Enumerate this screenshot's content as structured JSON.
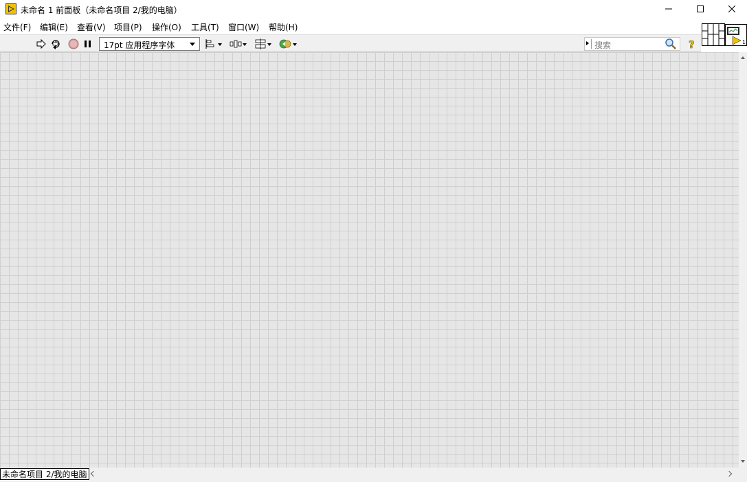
{
  "window": {
    "title": "未命名 1 前面板（未命名项目 2/我的电脑）",
    "icons": {
      "app": "labview-run-icon",
      "minimize": "minimize-icon",
      "maximize": "maximize-icon",
      "close": "close-icon"
    }
  },
  "menubar": {
    "items": [
      {
        "label": "文件(F)"
      },
      {
        "label": "编辑(E)"
      },
      {
        "label": "查看(V)"
      },
      {
        "label": "项目(P)"
      },
      {
        "label": "操作(O)"
      },
      {
        "label": "工具(T)"
      },
      {
        "label": "窗口(W)"
      },
      {
        "label": "帮助(H)"
      }
    ]
  },
  "toolbar": {
    "font_select": "17pt 应用程序字体",
    "search_placeholder": "搜索",
    "icons": [
      "run-arrow-icon",
      "run-continuously-icon",
      "abort-icon",
      "pause-icon",
      "align-objects-icon",
      "distribute-objects-icon",
      "resize-objects-icon",
      "reorder-icon",
      "search-icon",
      "context-help-icon"
    ]
  },
  "statusbar": {
    "project_label": "未命名项目 2/我的电脑"
  },
  "colors": {
    "canvas_bg": "#e6e6e6",
    "grid_line": "#cfcfcf",
    "toolbar_bg": "#f0f0f0",
    "app_icon": "#e8b800"
  }
}
